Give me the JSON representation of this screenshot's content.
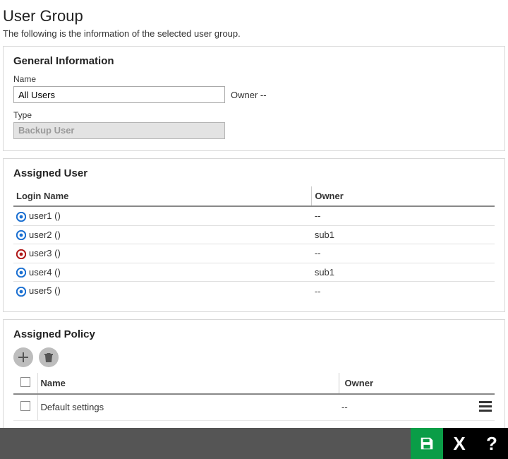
{
  "header": {
    "title": "User Group",
    "subtitle": "The following is the information of the selected user group."
  },
  "general": {
    "title": "General Information",
    "name_label": "Name",
    "name_value": "All Users",
    "owner_label": "Owner ",
    "owner_value": "--",
    "type_label": "Type",
    "type_value": "Backup User"
  },
  "assigned_user": {
    "title": "Assigned User",
    "columns": {
      "login": "Login Name",
      "owner": "Owner"
    },
    "rows": [
      {
        "login": "user1 ()",
        "owner": "--",
        "icon_color": "#1a6fd1"
      },
      {
        "login": "user2 ()",
        "owner": "sub1",
        "icon_color": "#1a6fd1"
      },
      {
        "login": "user3 ()",
        "owner": "--",
        "icon_color": "#b01818"
      },
      {
        "login": "user4 ()",
        "owner": "sub1",
        "icon_color": "#1a6fd1"
      },
      {
        "login": "user5 ()",
        "owner": "--",
        "icon_color": "#1a6fd1"
      }
    ]
  },
  "assigned_policy": {
    "title": "Assigned Policy",
    "columns": {
      "name": "Name",
      "owner": "Owner"
    },
    "rows": [
      {
        "name": "Default settings",
        "owner": "--"
      }
    ]
  }
}
